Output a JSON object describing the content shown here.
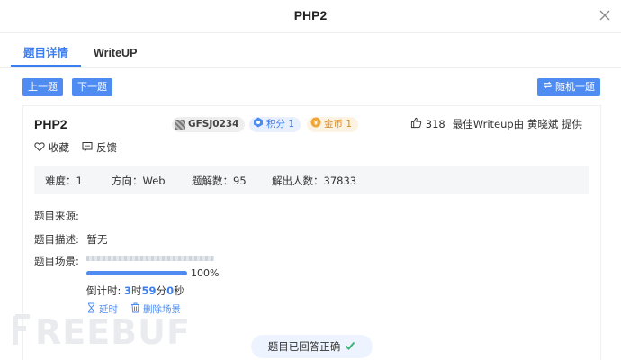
{
  "modal": {
    "title": "PHP2"
  },
  "tabs": [
    {
      "label": "题目详情",
      "active": true
    },
    {
      "label": "WriteUP",
      "active": false
    }
  ],
  "toolbar": {
    "prev_label": "上一题",
    "next_label": "下一题",
    "random_label": "随机一题"
  },
  "problem": {
    "title": "PHP2",
    "id": "GFSJ0234",
    "score": "积分 1",
    "coin": "金币 1",
    "likes": "318",
    "writeup_credit": "最佳Writeup由 黄晓斌 提供",
    "favorite_label": "收藏",
    "feedback_label": "反馈"
  },
  "info": {
    "difficulty": "难度：1",
    "direction": "方向：Web",
    "solves": "题解数：95",
    "solvers": "解出人数：37833"
  },
  "details": {
    "source_label": "题目来源:",
    "desc_label": "题目描述:",
    "desc_value": "暂无",
    "env_label": "题目场景:"
  },
  "env": {
    "progress_percent": 100,
    "progress_text": "100%",
    "countdown_prefix": "倒计时: ",
    "hours": "3",
    "hours_unit": "时",
    "minutes": "59",
    "minutes_unit": "分",
    "seconds": "0",
    "seconds_unit": "秒",
    "extend_label": "延时",
    "delete_label": "删除场景"
  },
  "toast": {
    "text": "题目已回答正确"
  },
  "watermark": {
    "text": "REEBUF"
  },
  "colors": {
    "accent": "#4e8cf1",
    "coin": "#e28a1a",
    "success": "#3cb371"
  }
}
